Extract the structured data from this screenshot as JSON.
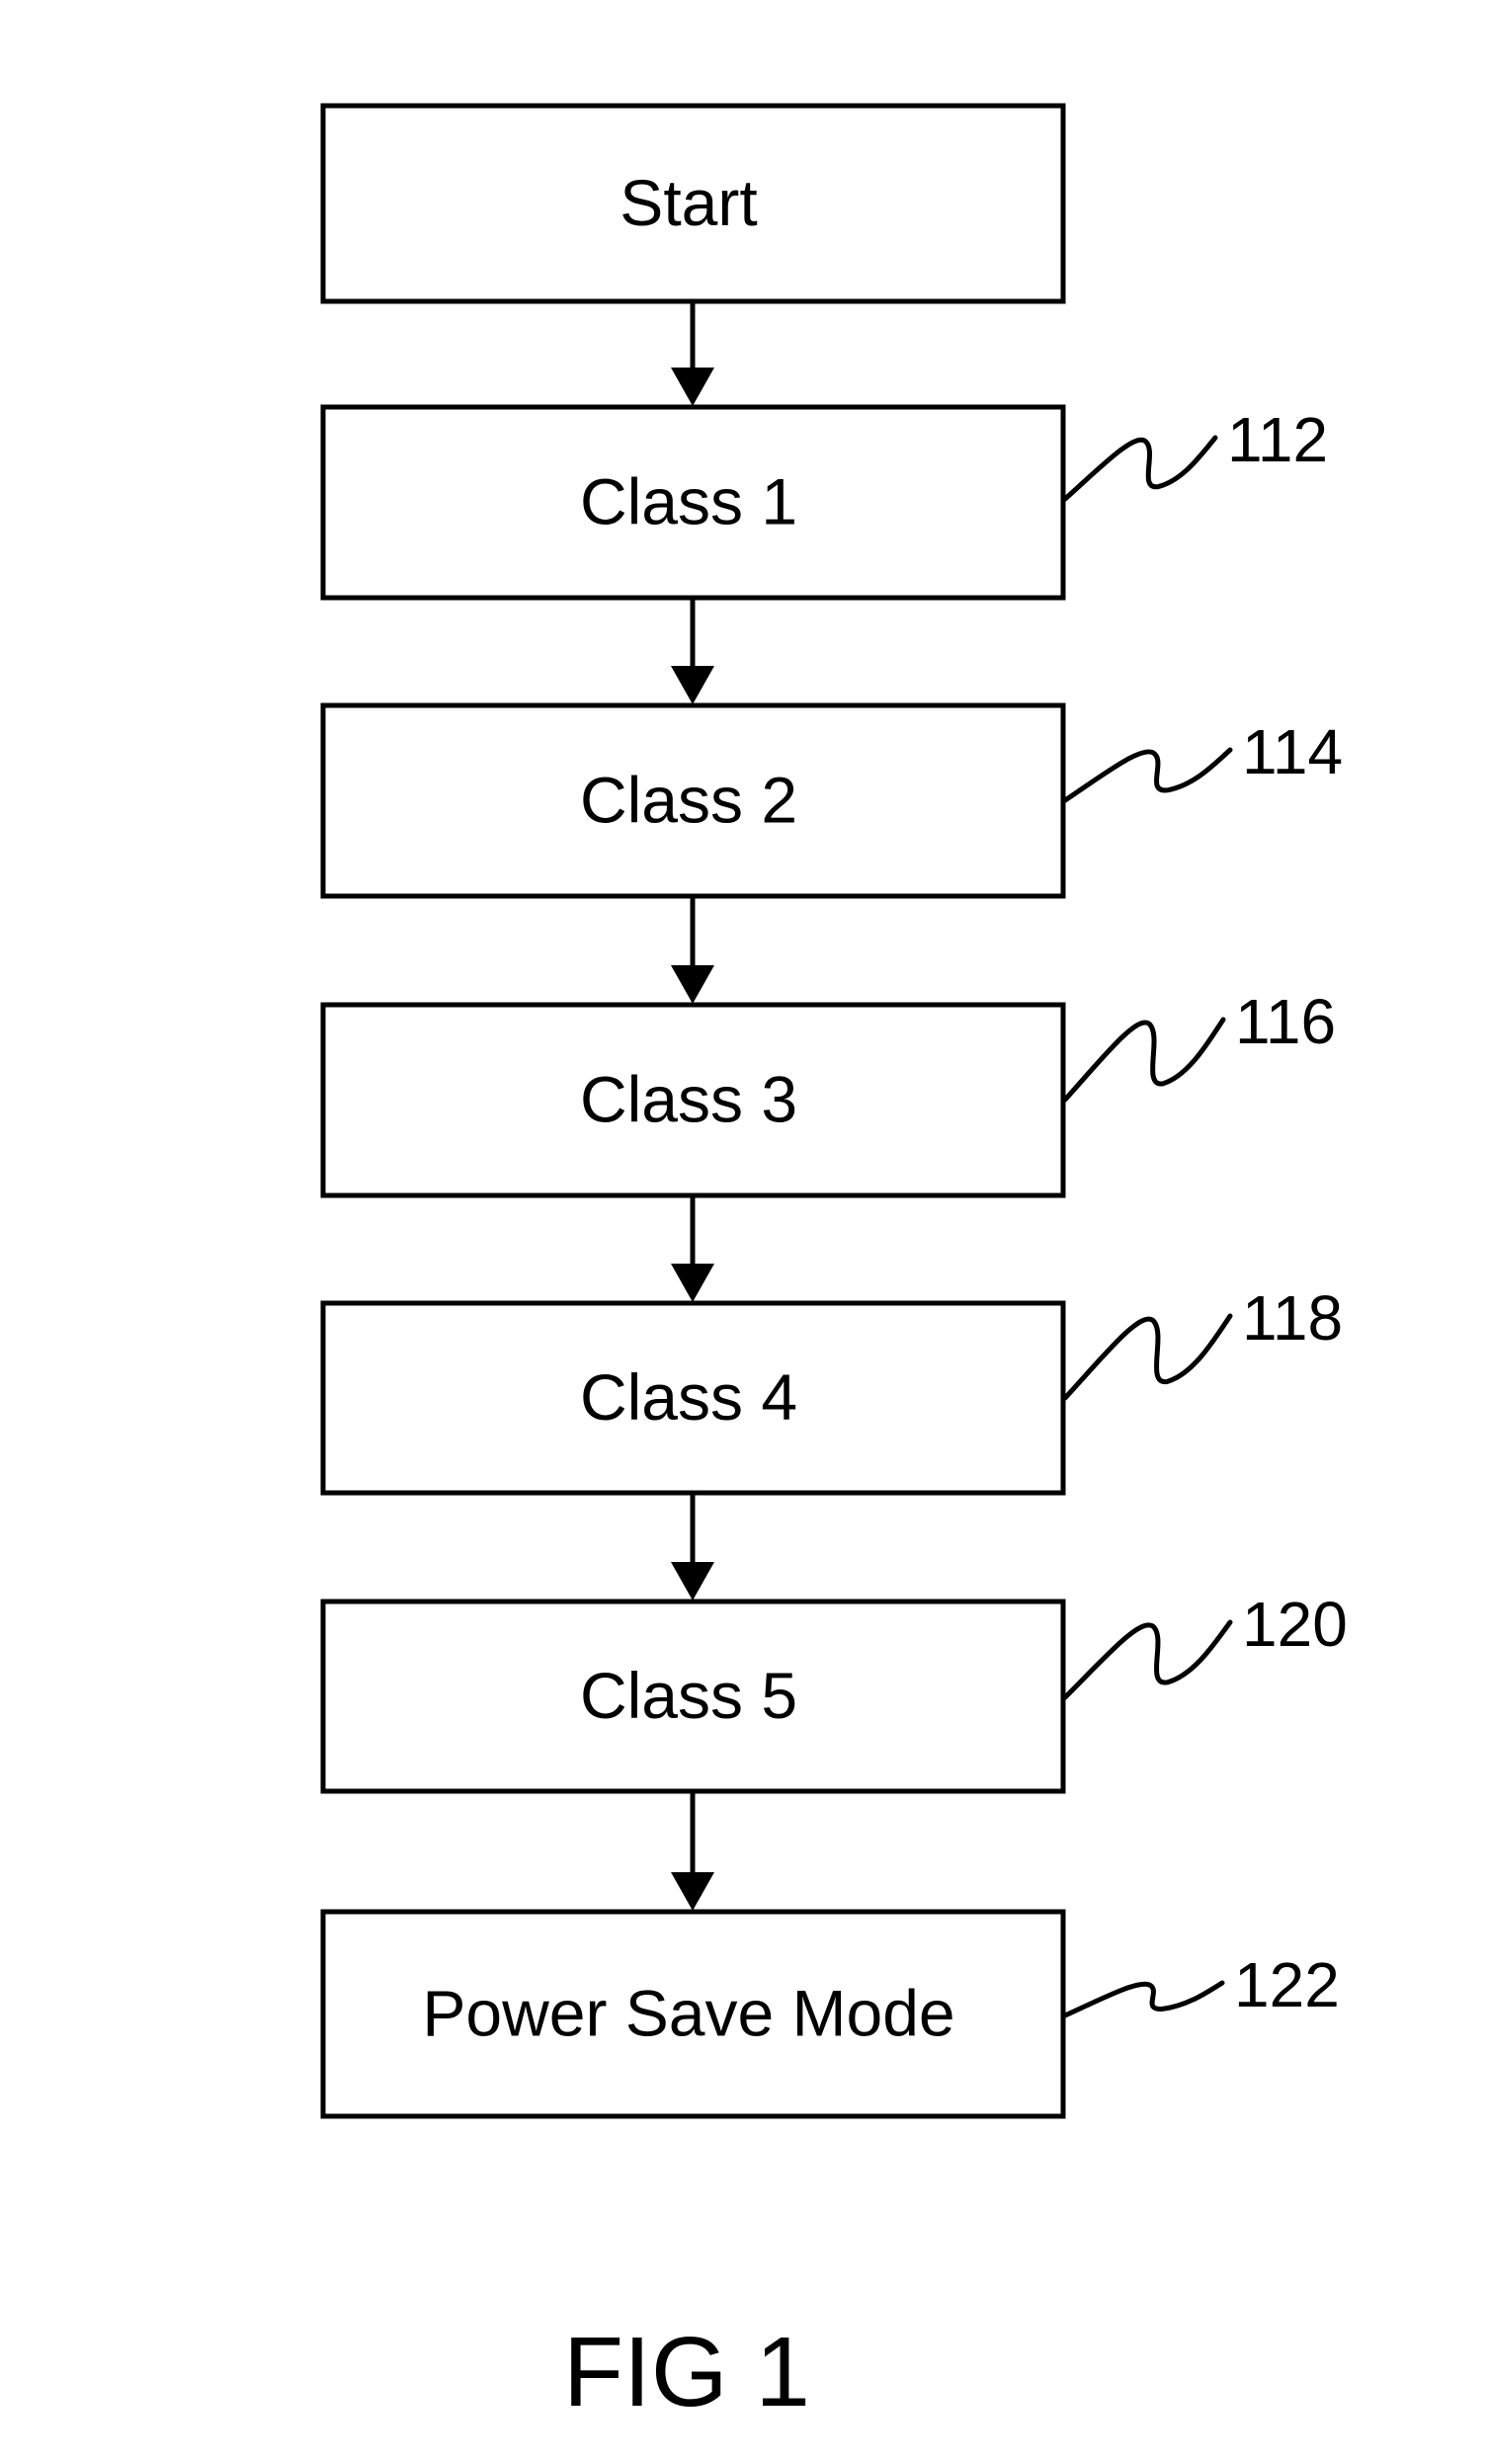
{
  "figure": {
    "caption": "FIG 1",
    "type": "flowchart",
    "direction": "top-to-bottom"
  },
  "nodes": [
    {
      "id": "start",
      "label": "Start",
      "ref": ""
    },
    {
      "id": "class-1",
      "label": "Class 1",
      "ref": "112"
    },
    {
      "id": "class-2",
      "label": "Class 2",
      "ref": "114"
    },
    {
      "id": "class-3",
      "label": "Class 3",
      "ref": "116"
    },
    {
      "id": "class-4",
      "label": "Class 4",
      "ref": "118"
    },
    {
      "id": "class-5",
      "label": "Class 5",
      "ref": "120"
    },
    {
      "id": "power-save-mode",
      "label": "Power Save Mode",
      "ref": "122"
    }
  ],
  "edges": [
    {
      "from": "start",
      "to": "class-1"
    },
    {
      "from": "class-1",
      "to": "class-2"
    },
    {
      "from": "class-2",
      "to": "class-3"
    },
    {
      "from": "class-3",
      "to": "class-4"
    },
    {
      "from": "class-4",
      "to": "class-5"
    },
    {
      "from": "class-5",
      "to": "power-save-mode"
    }
  ],
  "colors": {
    "stroke": "#000000",
    "background": "#ffffff"
  }
}
